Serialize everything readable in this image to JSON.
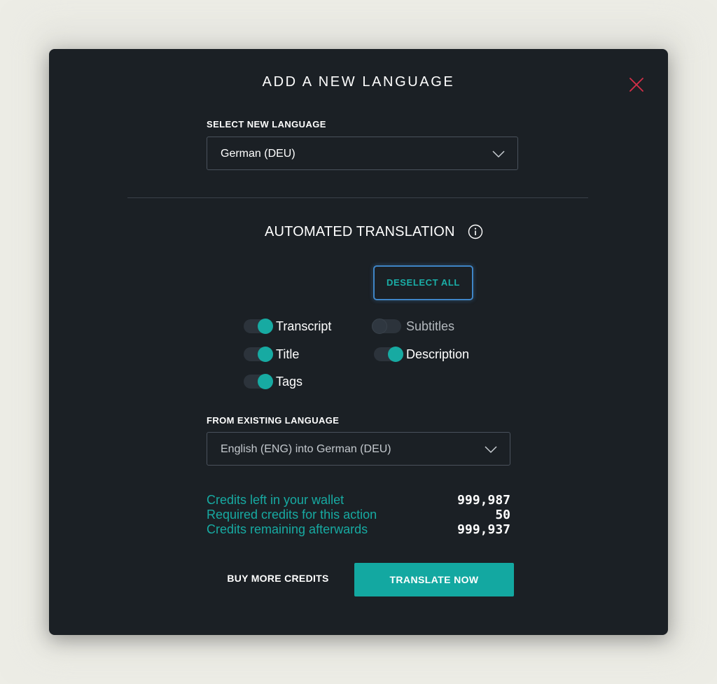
{
  "modal": {
    "title": "ADD A NEW LANGUAGE",
    "close_icon": "close-icon"
  },
  "select_language": {
    "label": "SELECT NEW LANGUAGE",
    "value": "German (DEU)"
  },
  "automated_translation": {
    "title": "AUTOMATED TRANSLATION",
    "info_icon": "info-icon",
    "deselect_label": "DESELECT ALL",
    "toggles": [
      {
        "label": "Transcript",
        "on": true
      },
      {
        "label": "Subtitles",
        "on": false
      },
      {
        "label": "Title",
        "on": true
      },
      {
        "label": "Description",
        "on": true
      },
      {
        "label": "Tags",
        "on": true
      }
    ]
  },
  "from_language": {
    "label": "FROM EXISTING LANGUAGE",
    "value": "English (ENG) into German (DEU)"
  },
  "credits": [
    {
      "label": "Credits left in your wallet",
      "value": "999,987"
    },
    {
      "label": "Required credits for this action",
      "value": "50"
    },
    {
      "label": "Credits remaining afterwards",
      "value": "999,937"
    }
  ],
  "actions": {
    "buy_label": "BUY MORE CREDITS",
    "translate_label": "TRANSLATE NOW"
  },
  "colors": {
    "accent": "#17aaa2",
    "close": "#d42f48",
    "modal_bg": "#1b2025",
    "focus_ring": "#3f86c9"
  }
}
